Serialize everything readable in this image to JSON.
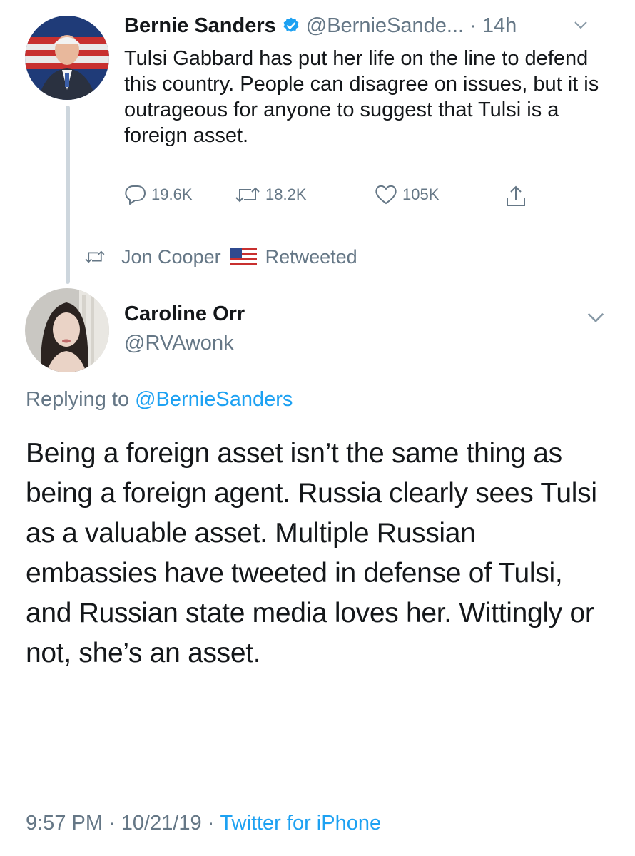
{
  "original_tweet": {
    "author_name": "Bernie Sanders",
    "handle_time": "@BernieSande... · 14h",
    "text": "Tulsi Gabbard has put her life on the line to defend this country. People can disagree on issues, but it is outrageous for anyone to suggest that Tulsi is a foreign asset.",
    "replies": "19.6K",
    "retweets": "18.2K",
    "likes": "105K"
  },
  "retweet_banner": {
    "user": "Jon Cooper",
    "label": "Retweeted"
  },
  "main_tweet": {
    "author_name": "Caroline Orr",
    "handle": "@RVAwonk",
    "replying_prefix": "Replying to",
    "replying_to": "@BernieSanders",
    "text": "Being a foreign asset isn’t the same thing as being a foreign agent. Russia clearly sees Tulsi as a valuable asset. Multiple Russian embassies have tweeted in defense of Tulsi, and Russian state media loves her. Wittingly or not, she’s an asset.",
    "timestamp": "9:57 PM · 10/21/19 · ",
    "source": "Twitter for iPhone"
  },
  "colors": {
    "accent": "#1da1f2",
    "secondary_text": "#657786",
    "thread_line": "#cdd6dd"
  },
  "icons": [
    "verified-badge-icon",
    "chevron-down-icon",
    "reply-icon",
    "retweet-icon",
    "like-icon",
    "share-icon",
    "us-flag-icon"
  ]
}
